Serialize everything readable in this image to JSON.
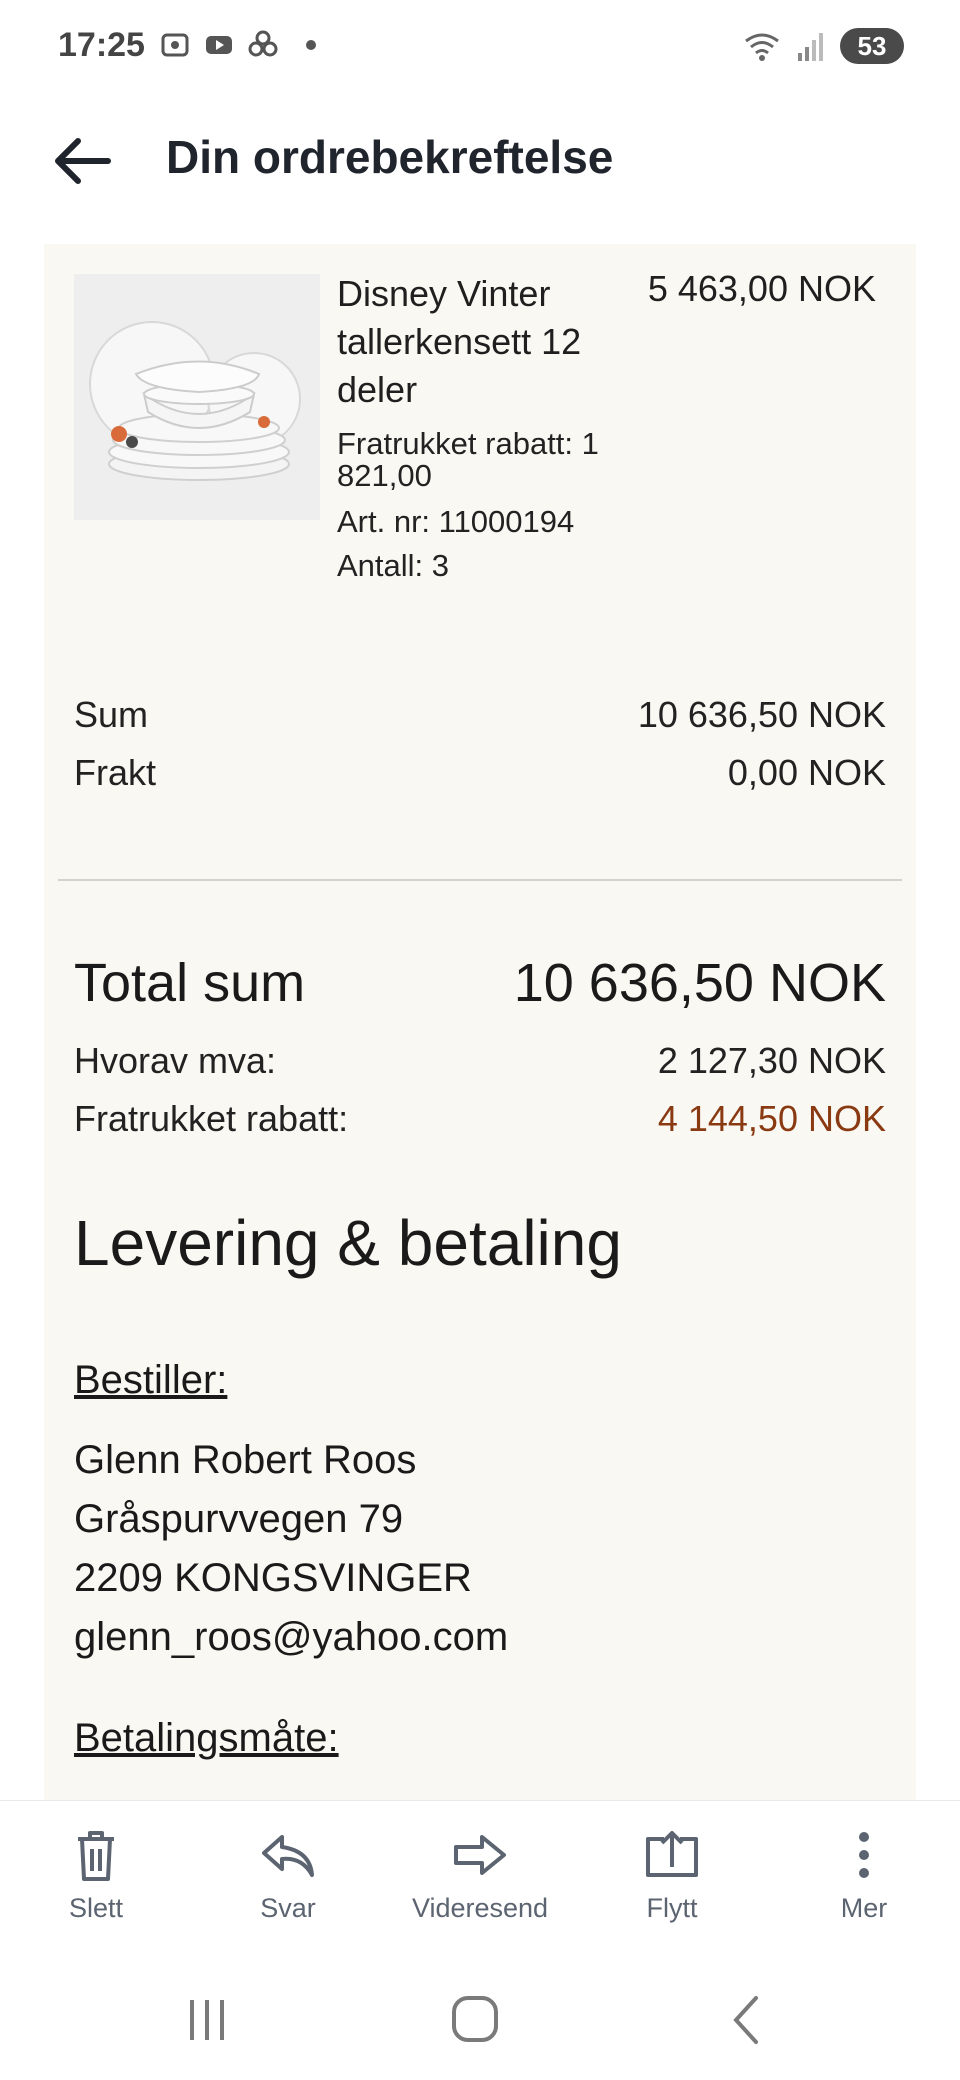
{
  "status_bar": {
    "time": "17:25",
    "battery": "53"
  },
  "header": {
    "title": "Din ordrebekreftelse"
  },
  "order": {
    "product": {
      "name": "Disney Vinter tallerkensett 12 deler",
      "price": "5 463,00 NOK",
      "discount": "Fratrukket rabatt: 1 821,00",
      "article": "Art. nr: 11000194",
      "quantity": "Antall: 3"
    },
    "summary": {
      "sum_label": "Sum",
      "sum_value": "10 636,50 NOK",
      "shipping_label": "Frakt",
      "shipping_value": "0,00 NOK"
    },
    "totals": {
      "total_label": "Total sum",
      "total_value": "10 636,50 NOK",
      "vat_label": "Hvorav mva:",
      "vat_value": "2 127,30 NOK",
      "discount_label": "Fratrukket rabatt:",
      "discount_value": "4 144,50 NOK"
    }
  },
  "delivery": {
    "heading": "Levering & betaling",
    "orderer_label": "Bestiller:",
    "name": "Glenn Robert Roos",
    "street": "Gråspurvvegen 79",
    "city": "2209 KONGSVINGER",
    "email": "glenn_roos@yahoo.com",
    "payment_label": "Betalingsmåte:"
  },
  "actions": [
    {
      "label": "Slett",
      "icon": "trash-icon"
    },
    {
      "label": "Svar",
      "icon": "reply-icon"
    },
    {
      "label": "Videresend",
      "icon": "forward-icon"
    },
    {
      "label": "Flytt",
      "icon": "move-icon"
    },
    {
      "label": "Mer",
      "icon": "more-icon"
    }
  ],
  "colors": {
    "card_bg": "#faf8f2",
    "discount": "#8a3a12",
    "icon": "#5b6470"
  }
}
